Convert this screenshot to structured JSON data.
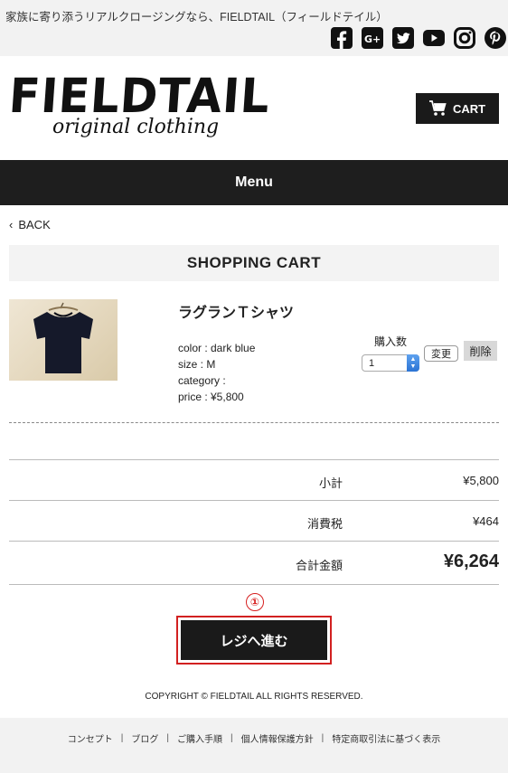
{
  "top_bar": {
    "tagline": "家族に寄り添うリアルクロージングなら、FIELDTAIL（フィールドテイル）",
    "social_icons": [
      "facebook-icon",
      "google-plus-icon",
      "twitter-icon",
      "youtube-icon",
      "instagram-icon",
      "pinterest-icon"
    ]
  },
  "header": {
    "logo_main": "FIELDTAIL",
    "logo_sub": "original clothing",
    "cart_label": "CART"
  },
  "nav": {
    "menu_label": "Menu"
  },
  "back_label": "BACK",
  "page_title": "SHOPPING CART",
  "cart_item": {
    "name": "ラグランＴシャツ",
    "color": "color : dark blue",
    "size": "size : M",
    "category": "category :",
    "price": "price : ¥5,800",
    "quantity_label": "購入数",
    "quantity_value": "1",
    "change_label": "変更",
    "delete_label": "削除"
  },
  "totals": {
    "subtotal_label": "小計",
    "subtotal_value": "¥5,800",
    "tax_label": "消費税",
    "tax_value": "¥464",
    "total_label": "合計金額",
    "total_value": "¥6,264"
  },
  "annotation_marker": "①",
  "checkout_label": "レジへ進む",
  "copyright": "COPYRIGHT © FIELDTAIL ALL RIGHTS RESERVED.",
  "footer_links": [
    "コンセプト",
    "ブログ",
    "ご購入手順",
    "個人情報保護方針",
    "特定商取引法に基づく表示"
  ],
  "colors": {
    "accent_dark": "#1a1a1a",
    "highlight_red": "#d22020",
    "light_gray": "#f2f2f2"
  }
}
